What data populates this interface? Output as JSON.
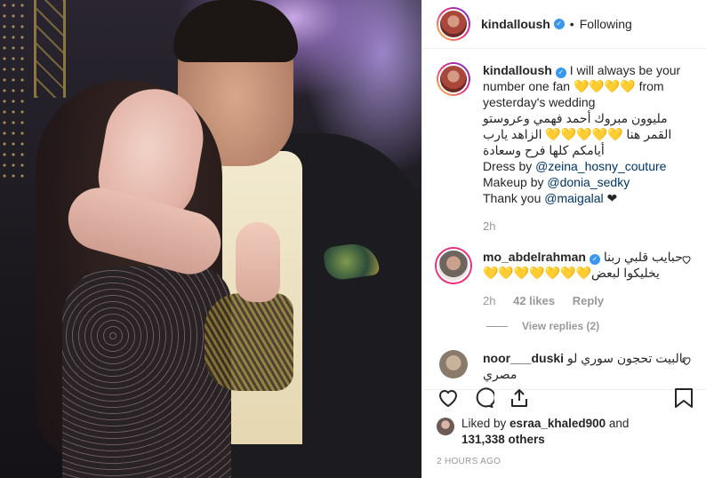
{
  "post": {
    "username": "kindalloush",
    "follow_status": "Following",
    "separator": "•"
  },
  "caption": {
    "username": "kindalloush",
    "line1": "I will always be your number one fan 💛💛💛💛 from yesterday's wedding",
    "arabic": "مليوون مبروك أحمد فهمي وعروستو القمر هنا 💛💛💛💛💛 الزاهد يارب أيامكم كلها فرح وسعادة",
    "dress_label": "Dress by ",
    "dress_mention": "@zeina_hosny_couture",
    "makeup_label": "Makeup by ",
    "makeup_mention": "@donia_sedky",
    "thanks_label": "Thank you ",
    "thanks_mention": "@maigalal",
    "thanks_suffix": " ❤",
    "time": "2h"
  },
  "comments": [
    {
      "username": "mo_abdelrahman",
      "text": "حبايب قلبي ربنا يخليكوا لبعض💛💛💛💛💛💛💛",
      "time": "2h",
      "likes": "42 likes",
      "reply": "Reply",
      "view_replies": "View replies (2)"
    },
    {
      "username": "noor___duski",
      "text": "بالبيت تحجون سوري لو مصري"
    }
  ],
  "likes": {
    "prefix": "Liked by ",
    "user": "esraa_khaled900",
    "and": " and",
    "count": "131,338 others"
  },
  "timestamp": "2 HOURS AGO",
  "icons": [
    "heart-icon",
    "comment-icon",
    "share-icon",
    "bookmark-icon",
    "verified-badge-icon"
  ],
  "colors": {
    "link": "#003569",
    "verified": "#3897f0",
    "muted": "#999999"
  }
}
